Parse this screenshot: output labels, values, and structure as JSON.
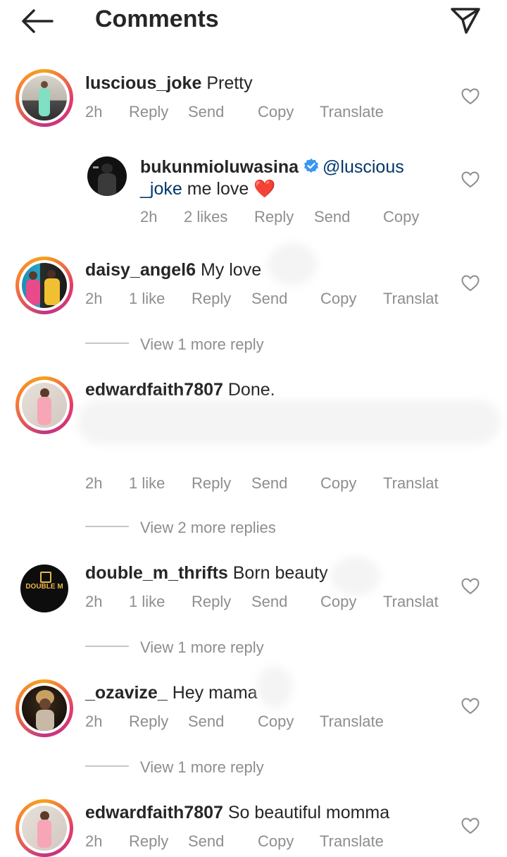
{
  "header": {
    "title": "Comments"
  },
  "comments": [
    {
      "username": "luscious_joke",
      "text": "Pretty",
      "time": "2h",
      "likes": "",
      "actions": [
        "Reply",
        "Send",
        "Copy",
        "Translate"
      ]
    },
    {
      "username": "bukunmioluwasina",
      "mention": "@luscious",
      "mention_cont": "_joke",
      "text": "me love ❤️",
      "time": "2h",
      "likes": "2 likes",
      "actions": [
        "Reply",
        "Send",
        "Copy"
      ]
    },
    {
      "username": "daisy_angel6",
      "text": "My love",
      "time": "2h",
      "likes": "1 like",
      "actions": [
        "Reply",
        "Send",
        "Copy",
        "Translat"
      ],
      "view_more": "View 1 more reply"
    },
    {
      "username": "edwardfaith7807",
      "text": "Done.",
      "time": "2h",
      "likes": "1 like",
      "actions": [
        "Reply",
        "Send",
        "Copy",
        "Translat"
      ],
      "view_more": "View 2 more replies"
    },
    {
      "username": "double_m_thrifts",
      "text": "Born beauty",
      "time": "2h",
      "likes": "1 like",
      "actions": [
        "Reply",
        "Send",
        "Copy",
        "Translat"
      ],
      "view_more": "View 1 more reply",
      "avatar_text": "DOUBLE M"
    },
    {
      "username": "_ozavize_",
      "text": "Hey mama",
      "time": "2h",
      "likes": "",
      "actions": [
        "Reply",
        "Send",
        "Copy",
        "Translate"
      ],
      "view_more": "View 1 more reply"
    },
    {
      "username": "edwardfaith7807",
      "text": "So beautiful momma",
      "time": "2h",
      "likes": "",
      "actions": [
        "Reply",
        "Send",
        "Copy",
        "Translate"
      ]
    }
  ],
  "icons": {
    "back": "arrow-left-icon",
    "send": "paper-plane-icon",
    "like": "heart-outline-icon",
    "verified": "verified-badge-icon"
  },
  "colors": {
    "meta": "#8e8e8e",
    "mention": "#00376b",
    "verified": "#3897f0",
    "heart": "#e0245e"
  }
}
